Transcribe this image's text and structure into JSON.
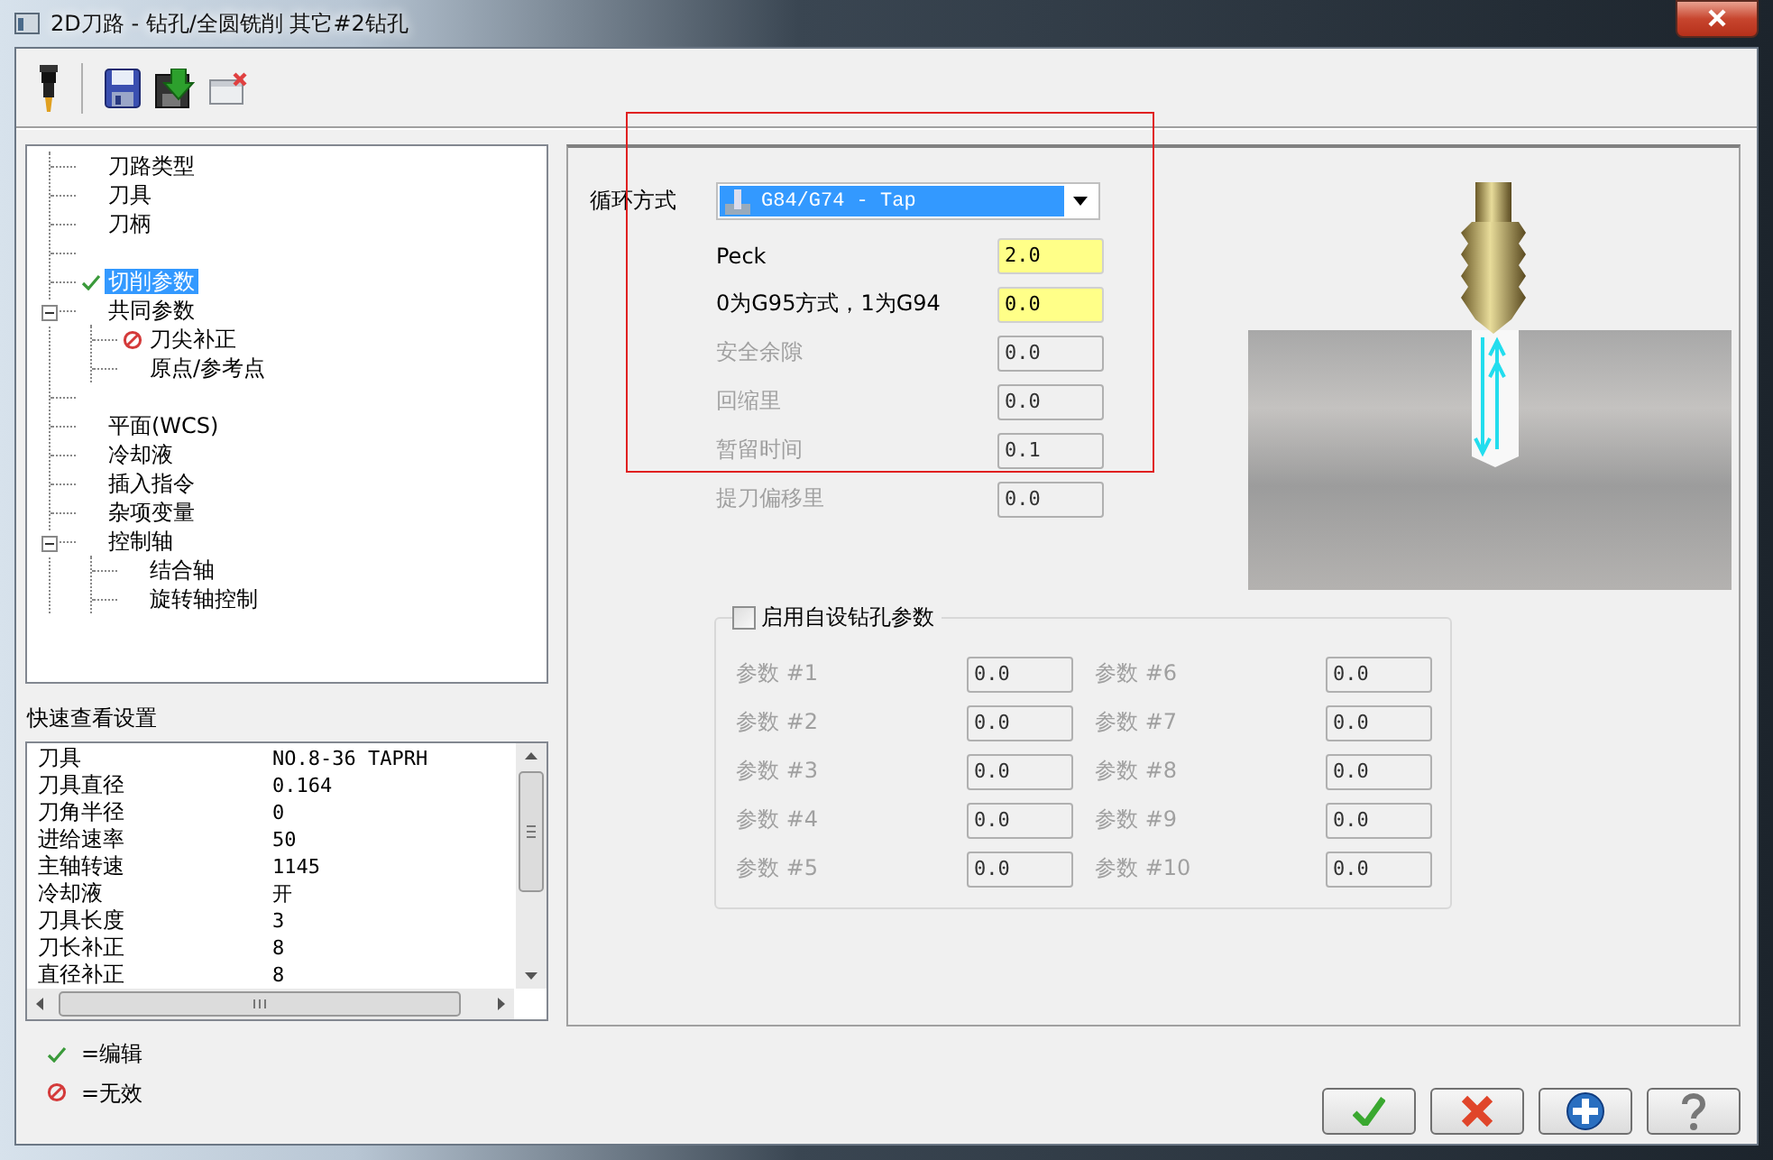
{
  "window": {
    "title": "2D刀路 - 钻孔/全圆铣削 其它#2钻孔"
  },
  "tree": [
    {
      "kind": "item",
      "label": "刀路类型",
      "selected": false
    },
    {
      "kind": "item",
      "label": "刀具",
      "selected": false
    },
    {
      "kind": "item",
      "label": "刀柄",
      "selected": false
    },
    {
      "kind": "spacer"
    },
    {
      "kind": "edited",
      "label": "切削参数",
      "selected": true
    },
    {
      "kind": "item",
      "label": "共同参数",
      "selected": false,
      "expanded": true,
      "children": [
        {
          "kind": "invalid",
          "label": "刀尖补正",
          "selected": false
        },
        {
          "kind": "item",
          "label": "原点/参考点",
          "selected": false
        }
      ]
    },
    {
      "kind": "spacer"
    },
    {
      "kind": "item",
      "label": "平面(WCS)",
      "selected": false
    },
    {
      "kind": "item",
      "label": "冷却液",
      "selected": false
    },
    {
      "kind": "item",
      "label": "插入指令",
      "selected": false
    },
    {
      "kind": "item",
      "label": "杂项变量",
      "selected": false
    },
    {
      "kind": "item",
      "label": "控制轴",
      "selected": false,
      "expanded": true,
      "children": [
        {
          "kind": "item",
          "label": "结合轴",
          "selected": false
        },
        {
          "kind": "item",
          "label": "旋转轴控制",
          "selected": false
        }
      ]
    }
  ],
  "quick_view": {
    "title": "快速查看设置",
    "rows": [
      {
        "name": "刀具",
        "value": "NO.8-36 TAPRH"
      },
      {
        "name": "刀具直径",
        "value": "0.164"
      },
      {
        "name": "刀角半径",
        "value": "0"
      },
      {
        "name": "进给速率",
        "value": "50"
      },
      {
        "name": "主轴转速",
        "value": "1145"
      },
      {
        "name": "冷却液",
        "value": "开"
      },
      {
        "name": "刀具长度",
        "value": "3"
      },
      {
        "name": "刀长补正",
        "value": "8"
      },
      {
        "name": "直径补正",
        "value": "8"
      }
    ]
  },
  "legend": [
    {
      "kind": "edited",
      "label": "=编辑"
    },
    {
      "kind": "invalid",
      "label": "=无效"
    }
  ],
  "cycle": {
    "label": "循环方式",
    "value": "G84/G74 - Tap"
  },
  "fields": [
    {
      "label": "Peck",
      "value": "2.0",
      "highlighted": true,
      "disabled": false
    },
    {
      "label": "0为G95方式，1为G94",
      "value": "0.0",
      "highlighted": true,
      "disabled": false
    },
    {
      "label": "安全余隙",
      "value": "0.0",
      "highlighted": false,
      "disabled": true
    },
    {
      "label": "回缩里",
      "value": "0.0",
      "highlighted": false,
      "disabled": true
    },
    {
      "label": "暂留时间",
      "value": "0.1",
      "highlighted": false,
      "disabled": true
    },
    {
      "label": "提刀偏移里",
      "value": "0.0",
      "highlighted": false,
      "disabled": true
    }
  ],
  "custom_params": {
    "label": "启用自设钻孔参数",
    "checked": false,
    "params": [
      {
        "label": "参数 #1",
        "value": "0.0"
      },
      {
        "label": "参数 #2",
        "value": "0.0"
      },
      {
        "label": "参数 #3",
        "value": "0.0"
      },
      {
        "label": "参数 #4",
        "value": "0.0"
      },
      {
        "label": "参数 #5",
        "value": "0.0"
      },
      {
        "label": "参数 #6",
        "value": "0.0"
      },
      {
        "label": "参数 #7",
        "value": "0.0"
      },
      {
        "label": "参数 #8",
        "value": "0.0"
      },
      {
        "label": "参数 #9",
        "value": "0.0"
      },
      {
        "label": "参数 #10",
        "value": "0.0"
      }
    ]
  },
  "buttons": [
    {
      "kind": "ok"
    },
    {
      "kind": "cancel"
    },
    {
      "kind": "add"
    },
    {
      "kind": "help"
    }
  ]
}
